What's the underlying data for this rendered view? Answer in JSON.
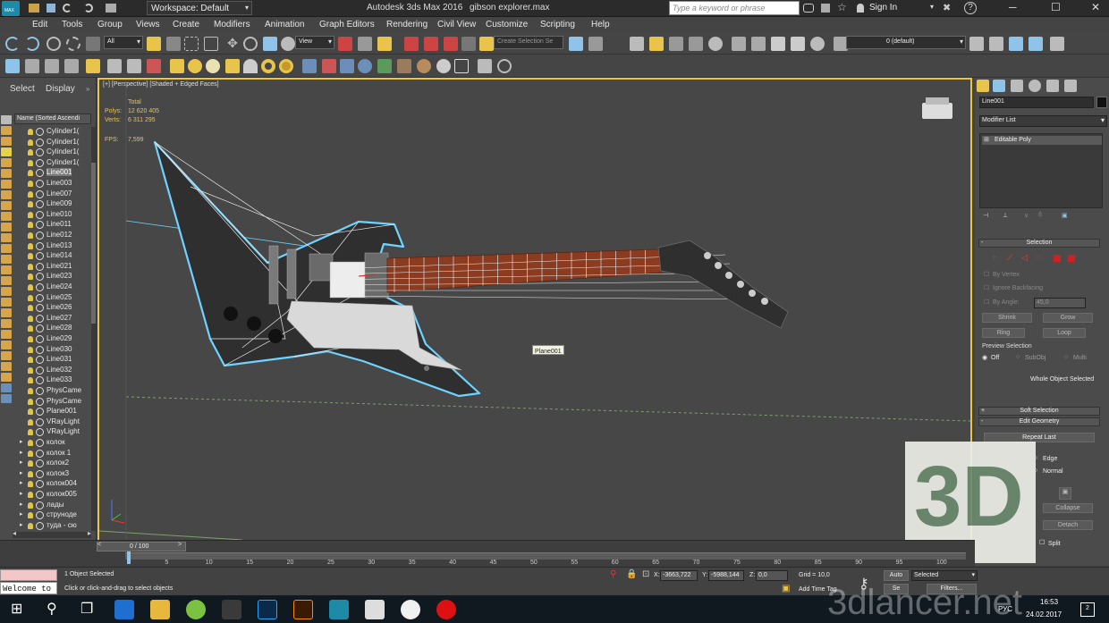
{
  "titlebar": {
    "logo_text": "MAX",
    "workspace": "Workspace: Default",
    "app_title": "Autodesk 3ds Max 2016",
    "file_title": "gibson explorer.max",
    "search_placeholder": "Type a keyword or phrase",
    "sign_in": "Sign In"
  },
  "menu": [
    "Edit",
    "Tools",
    "Group",
    "Views",
    "Create",
    "Modifiers",
    "Animation",
    "Graph Editors",
    "Rendering",
    "Civil View",
    "Customize",
    "Scripting",
    "Help"
  ],
  "toolbar": {
    "filter_value": "All",
    "view_value": "View",
    "create_selection_placeholder": "Create Selection Se",
    "layer_value": "0 (default)"
  },
  "scene_explorer": {
    "tab_select": "Select",
    "tab_display": "Display",
    "column_header": "Name (Sorted Ascendi",
    "items": [
      {
        "name": "Cylinder1(",
        "selected": false
      },
      {
        "name": "Cylinder1(",
        "selected": false
      },
      {
        "name": "Cylinder1(",
        "selected": false
      },
      {
        "name": "Cylinder1(",
        "selected": false
      },
      {
        "name": "Line001",
        "selected": true
      },
      {
        "name": "Line003",
        "selected": false
      },
      {
        "name": "Line007",
        "selected": false
      },
      {
        "name": "Line009",
        "selected": false
      },
      {
        "name": "Line010",
        "selected": false
      },
      {
        "name": "Line011",
        "selected": false
      },
      {
        "name": "Line012",
        "selected": false
      },
      {
        "name": "Line013",
        "selected": false
      },
      {
        "name": "Line014",
        "selected": false
      },
      {
        "name": "Line021",
        "selected": false
      },
      {
        "name": "Line023",
        "selected": false
      },
      {
        "name": "Line024",
        "selected": false
      },
      {
        "name": "Line025",
        "selected": false
      },
      {
        "name": "Line026",
        "selected": false
      },
      {
        "name": "Line027",
        "selected": false
      },
      {
        "name": "Line028",
        "selected": false
      },
      {
        "name": "Line029",
        "selected": false
      },
      {
        "name": "Line030",
        "selected": false
      },
      {
        "name": "Line031",
        "selected": false
      },
      {
        "name": "Line032",
        "selected": false
      },
      {
        "name": "Line033",
        "selected": false
      },
      {
        "name": "PhysCame",
        "selected": false
      },
      {
        "name": "PhysCame",
        "selected": false
      },
      {
        "name": "Plane001",
        "selected": false
      },
      {
        "name": "VRayLight",
        "selected": false
      },
      {
        "name": "VRayLight",
        "selected": false
      },
      {
        "name": "колок",
        "selected": false
      },
      {
        "name": "колок 1",
        "selected": false
      },
      {
        "name": "колок2",
        "selected": false
      },
      {
        "name": "колок3",
        "selected": false
      },
      {
        "name": "колок004",
        "selected": false
      },
      {
        "name": "колок005",
        "selected": false
      },
      {
        "name": "лады",
        "selected": false
      },
      {
        "name": "струноде",
        "selected": false
      },
      {
        "name": "туда - сю",
        "selected": false
      }
    ]
  },
  "viewport": {
    "label": "[+] [Perspective] [Shaded + Edged Faces]",
    "stats_total": "Total",
    "polys_label": "Polys:",
    "polys_value": "12 620 405",
    "verts_label": "Verts:",
    "verts_value": "6 311 295",
    "fps_label": "FPS:",
    "fps_value": "7,599",
    "tooltip": "Plane001"
  },
  "command_panel": {
    "object_name": "Line001",
    "modifier_list": "Modifier List",
    "stack_item": "Editable Poly",
    "selection_title": "Selection",
    "by_vertex": "By Vertex",
    "ignore_backfacing": "Ignore Backfacing",
    "by_angle": "By Angle:",
    "angle_value": "45,0",
    "shrink": "Shrink",
    "grow": "Grow",
    "ring": "Ring",
    "loop": "Loop",
    "preview_selection": "Preview Selection",
    "off": "Off",
    "subobj": "SubObj",
    "multi": "Multi",
    "whole_selected": "Whole Object Selected",
    "soft_selection": "Soft Selection",
    "edit_geometry": "Edit Geometry",
    "repeat_last": "Repeat Last",
    "edge": "Edge",
    "normal": "Normal",
    "collapse": "Collapse",
    "detach": "Detach",
    "split": "Split"
  },
  "timeline": {
    "frame": "0 / 100",
    "ticks": [
      "5",
      "10",
      "15",
      "20",
      "25",
      "30",
      "35",
      "40",
      "45",
      "50",
      "55",
      "60",
      "65",
      "70",
      "75",
      "80",
      "85",
      "90",
      "95",
      "100"
    ]
  },
  "status": {
    "listener": "Welcome to",
    "selected": "1 Object Selected",
    "prompt": "Click or click-and-drag to select objects",
    "x_label": "X:",
    "x_value": "-3663,722",
    "y_label": "Y:",
    "y_value": "-5988,144",
    "z_label": "Z:",
    "z_value": "0,0",
    "grid": "Grid = 10,0",
    "add_time_tag": "Add Time Tag",
    "auto": "Auto",
    "set_key": "Se",
    "selected_dropdown": "Selected",
    "filters": "Filters..."
  },
  "watermark": {
    "logo": "3D",
    "site": "3dlancer.net"
  },
  "taskbar": {
    "lang": "РУС",
    "time": "16:53",
    "date": "24.02.2017",
    "notif_count": "2"
  },
  "colors": {
    "accent_yellow": "#e9c44a",
    "selection_blue": "#6fd3ff",
    "neck_brown": "#8b3b1f",
    "rollout_red": "#cc2b2b",
    "watermark_green": "#6b8a6e"
  }
}
